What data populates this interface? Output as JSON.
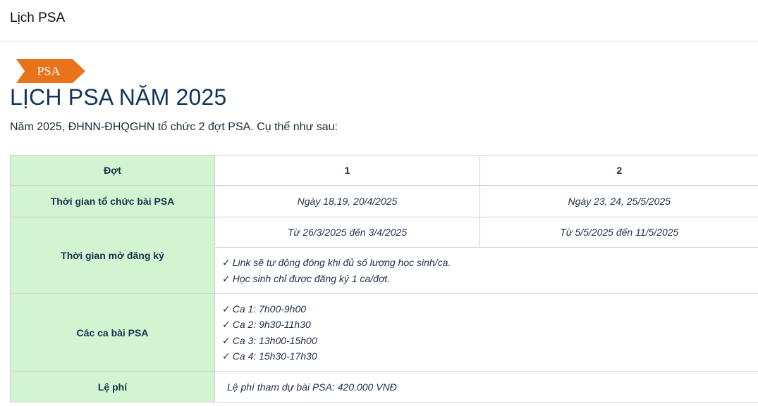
{
  "header": {
    "title": "Lịch PSA"
  },
  "tag": {
    "label": "PSA",
    "color": "#e8731a"
  },
  "main": {
    "title": "LỊCH PSA NĂM 2025",
    "intro": "Năm 2025, ĐHNN-ĐHQGHN tổ chức 2 đợt PSA. Cụ thể như sau:"
  },
  "table": {
    "header_bg": "#d2f4d1",
    "rows": {
      "dot": {
        "label": "Đợt",
        "v1": "1",
        "v2": "2"
      },
      "test_time": {
        "label": "Thời gian tổ chức bài PSA",
        "v1": "Ngày 18,19, 20/4/2025",
        "v2": "Ngày 23, 24, 25/5/2025"
      },
      "registration": {
        "label": "Thời gian mở đăng ký",
        "v1": "Từ 26/3/2025 đến 3/4/2025",
        "v2": "Từ 5/5/2025 đến 11/5/2025",
        "notes": [
          "Link sẽ tự động đóng khi đủ số lượng học sinh/ca.",
          "Học sinh chỉ được đăng ký 1 ca/đợt."
        ]
      },
      "sessions": {
        "label": "Các ca bài PSA",
        "items": [
          "Ca 1: 7h00-9h00",
          "Ca 2: 9h30-11h30",
          "Ca 3: 13h00-15h00",
          "Ca 4: 15h30-17h30"
        ]
      },
      "fee": {
        "label": "Lệ phí",
        "value": "Lệ phí tham dự bài PSA: 420.000 VNĐ"
      }
    }
  },
  "check_glyph": "✓"
}
